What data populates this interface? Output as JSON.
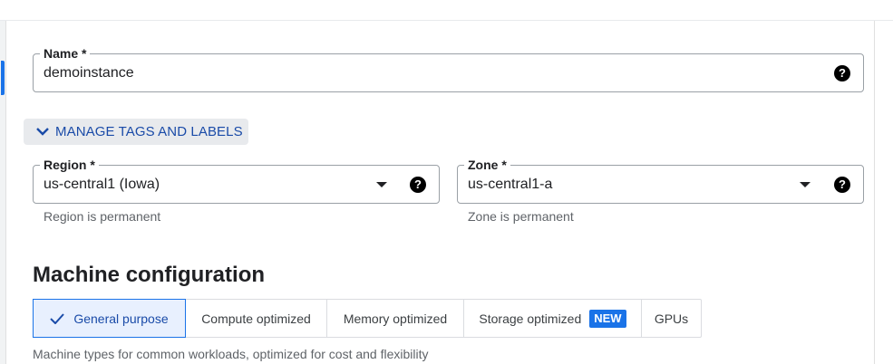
{
  "form": {
    "name_label": "Name *",
    "name_value": "demoinstance",
    "help_glyph": "?",
    "manage_tags_label": "MANAGE TAGS AND LABELS",
    "region_label": "Region *",
    "region_value": "us-central1 (Iowa)",
    "region_hint": "Region is permanent",
    "zone_label": "Zone *",
    "zone_value": "us-central1-a",
    "zone_hint": "Zone is permanent"
  },
  "machine": {
    "title": "Machine configuration",
    "tabs": [
      {
        "label": "General purpose",
        "active": true
      },
      {
        "label": "Compute optimized",
        "active": false
      },
      {
        "label": "Memory optimized",
        "active": false
      },
      {
        "label": "Storage optimized",
        "active": false,
        "badge": "NEW"
      },
      {
        "label": "GPUs",
        "active": false
      }
    ],
    "description": "Machine types for common workloads, optimized for cost and flexibility"
  },
  "colors": {
    "accent": "#1a73e8",
    "accent_text": "#1a4ba8",
    "active_bg": "#e8f0fe",
    "muted_text": "#5f6368"
  }
}
